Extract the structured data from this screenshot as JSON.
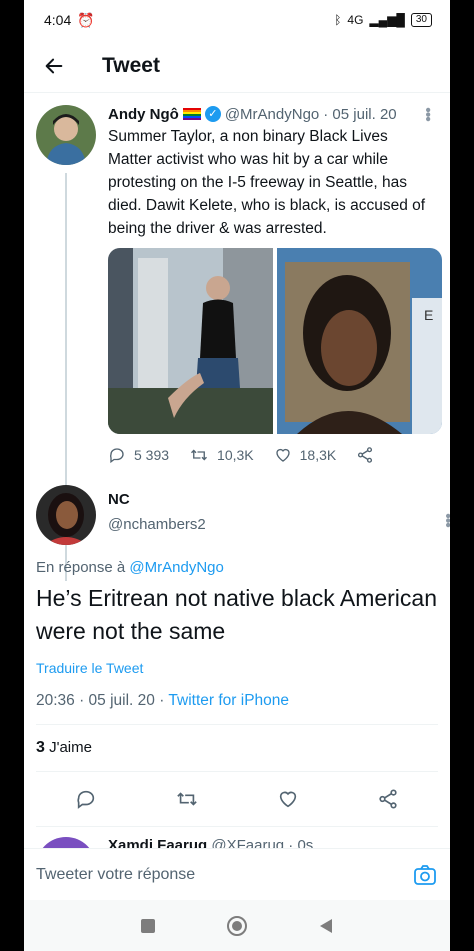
{
  "status_bar": {
    "time": "4:04",
    "network": "4G",
    "battery": "30"
  },
  "app_bar": {
    "title": "Tweet"
  },
  "original_tweet": {
    "name": "Andy Ngô",
    "handle": "@MrAndyNgo",
    "date": "· 05 juil. 20",
    "text": "Summer Taylor, a non binary Black Lives Matter activist who was hit by a car while protesting on the I-5 freeway in Seattle, has died. Dawit Kelete, who is black, is accused of being the driver & was arrested.",
    "replies": "5 393",
    "retweets": "10,3K",
    "likes": "18,3K"
  },
  "reply_tweet": {
    "name": "NC",
    "handle": "@nchambers2",
    "in_reply_prefix": "En réponse à",
    "in_reply_handle": "@MrAndyNgo",
    "text": "He’s Eritrean not native black American were not the same",
    "translate": "Traduire le Tweet",
    "timestamp": "20:36 · 05 juil. 20 · ",
    "source": "Twitter for iPhone",
    "like_count": "3",
    "like_label": "J'aime"
  },
  "next_tweet": {
    "name": "Xamdi Faaruq",
    "handle": "@XFaaruq · 0s"
  },
  "composer": {
    "placeholder": "Tweeter votre réponse"
  },
  "colors": {
    "accent": "#1d9bf0",
    "muted": "#536471",
    "text": "#0f1419"
  },
  "icons": [
    "arrow-left-icon",
    "verified-icon",
    "more-icon",
    "reply-icon",
    "retweet-icon",
    "like-icon",
    "share-icon",
    "camera-icon"
  ]
}
